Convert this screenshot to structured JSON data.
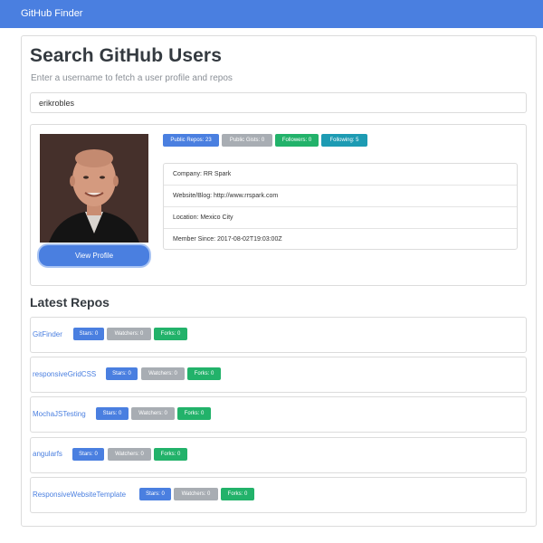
{
  "app": {
    "brand": "GitHub Finder"
  },
  "header": {
    "title": "Search GitHub Users",
    "subtitle": "Enter a username to fetch a user profile and repos"
  },
  "search": {
    "value": "erikrobles"
  },
  "profile": {
    "view_profile_label": "View Profile",
    "badges": {
      "public_repos": "Public Repos: 23",
      "public_gists": "Public Gists: 0",
      "followers": "Followers: 0",
      "following": "Following: 5"
    },
    "info": {
      "company": "Company: RR Spark",
      "website": "Website/Blog: http://www.rrspark.com",
      "location": "Location: Mexico City",
      "member_since": "Member Since: 2017-08-02T19:03:00Z"
    }
  },
  "repos_section": {
    "title": "Latest Repos"
  },
  "repos": [
    {
      "name": "GitFinder",
      "stars": "Stars: 0",
      "watchers": "Watchers: 0",
      "forks": "Forks: 0"
    },
    {
      "name": "responsiveGridCSS",
      "stars": "Stars: 0",
      "watchers": "Watchers: 0",
      "forks": "Forks: 0"
    },
    {
      "name": "MochaJSTesting",
      "stars": "Stars: 0",
      "watchers": "Watchers: 0",
      "forks": "Forks: 0"
    },
    {
      "name": "angularfs",
      "stars": "Stars: 0",
      "watchers": "Watchers: 0",
      "forks": "Forks: 0"
    },
    {
      "name": "ResponsiveWebsiteTemplate",
      "stars": "Stars: 0",
      "watchers": "Watchers: 0",
      "forks": "Forks: 0"
    }
  ],
  "colors": {
    "primary": "#4a7fe0",
    "secondary": "#a8adb3",
    "success": "#22b26a",
    "info": "#1d9bb3"
  }
}
